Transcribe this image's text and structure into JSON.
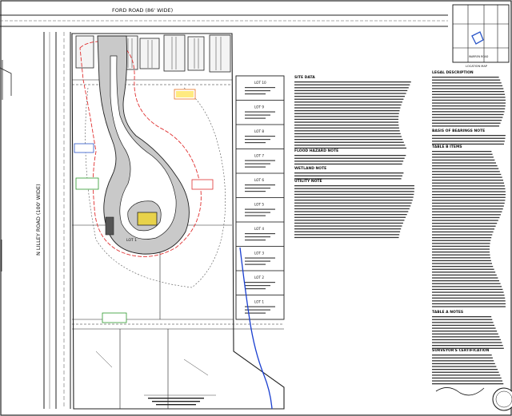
{
  "drawing": {
    "road_top": "FORD ROAD (86' WIDE)",
    "road_left": "N LILLEY ROAD (100' WIDE)",
    "location_map_label": "LOCATION MAP",
    "location_map_road": "WARREN ROAD"
  },
  "notes_center": {
    "site_data_heading": "SITE DATA",
    "flood_heading": "FLOOD HAZARD NOTE",
    "wetland_heading": "WETLAND NOTE",
    "utility_heading": "UTILITY NOTE"
  },
  "notes_right": {
    "legal_heading": "LEGAL DESCRIPTION",
    "basis_heading": "BASIS OF BEARINGS NOTE",
    "title_heading": "TABLE B ITEMS",
    "table_a_heading": "TABLE A NOTES",
    "surveyor_heading": "SURVEYOR'S CERTIFICATION"
  },
  "lots": [
    {
      "label": "LOT 10"
    },
    {
      "label": "LOT 9"
    },
    {
      "label": "LOT 8"
    },
    {
      "label": "LOT 7"
    },
    {
      "label": "LOT 6"
    },
    {
      "label": "LOT 5"
    },
    {
      "label": "LOT 4"
    },
    {
      "label": "LOT 3"
    },
    {
      "label": "LOT 2"
    },
    {
      "label": "LOT 1"
    }
  ],
  "center_lot_label": "LOT 1",
  "colors": {
    "ink": "#111111",
    "road_fill": "#c9c9c9",
    "boundary_red": "#e03030",
    "tag_orange": "#e87020",
    "tag_yellow": "#ffe14a",
    "tag_green": "#2d9a2d",
    "tag_blue": "#2a55c8",
    "drain_blue": "#1a3fd0"
  }
}
